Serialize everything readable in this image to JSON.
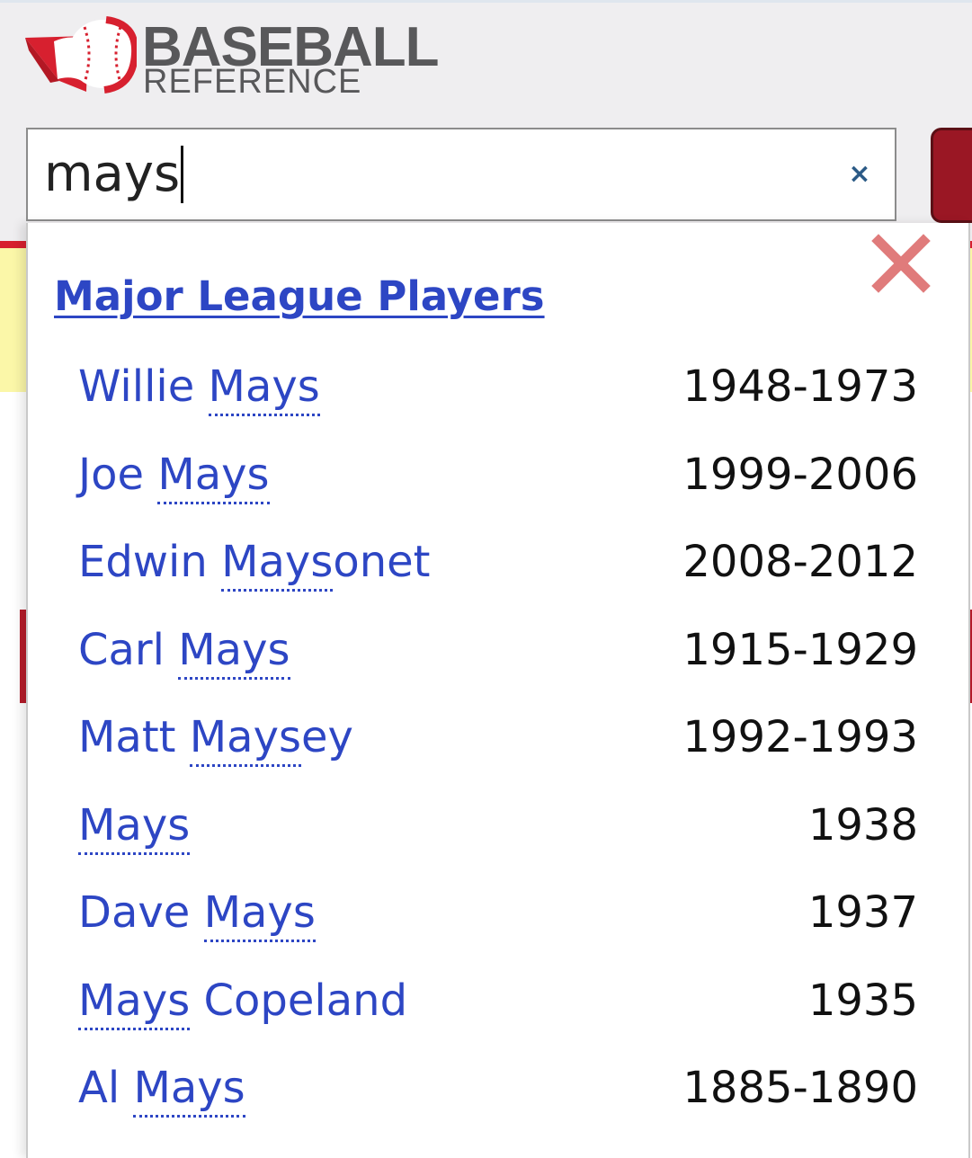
{
  "header": {
    "logo_line1": "BASEBALL",
    "logo_line2": "REFERENCE",
    "brand_red": "#d7202f",
    "text_gray": "#58585a"
  },
  "search": {
    "query": "mays",
    "clear_symbol": "×"
  },
  "dropdown": {
    "heading": "Major League Players",
    "link_color": "#2d46c4",
    "close_icon": "red-x-icon",
    "results": [
      {
        "pre": "Willie ",
        "match": "Mays",
        "post": "",
        "years": "1948-1973"
      },
      {
        "pre": "Joe ",
        "match": "Mays",
        "post": "",
        "years": "1999-2006"
      },
      {
        "pre": "Edwin ",
        "match": "Mays",
        "post": "onet",
        "years": "2008-2012"
      },
      {
        "pre": "Carl ",
        "match": "Mays",
        "post": "",
        "years": "1915-1929"
      },
      {
        "pre": "Matt ",
        "match": "Mays",
        "post": "ey",
        "years": "1992-1993"
      },
      {
        "pre": "",
        "match": "Mays",
        "post": "",
        "years": "1938"
      },
      {
        "pre": "Dave ",
        "match": "Mays",
        "post": "",
        "years": "1937"
      },
      {
        "pre": "",
        "match": "Mays",
        "post": " Copeland",
        "years": "1935"
      },
      {
        "pre": "Al ",
        "match": "Mays",
        "post": "",
        "years": "1885-1890"
      }
    ]
  }
}
